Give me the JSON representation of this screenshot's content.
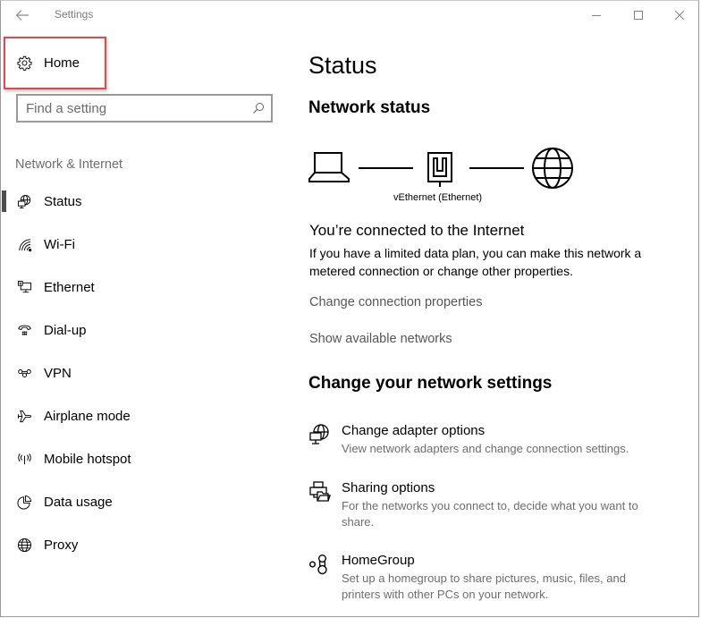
{
  "window": {
    "title": "Settings",
    "controls": {
      "back_icon": "arrow-left-icon",
      "minimize_icon": "minimize-icon",
      "maximize_icon": "maximize-icon",
      "close_icon": "close-icon"
    }
  },
  "sidebar": {
    "home": {
      "label": "Home",
      "icon": "gear-icon",
      "highlight_color": "#e5474b"
    },
    "search": {
      "placeholder": "Find a setting",
      "value": "",
      "icon": "search-icon"
    },
    "section_label": "Network & Internet",
    "items": [
      {
        "label": "Status",
        "icon": "globe-monitor-icon",
        "active": true
      },
      {
        "label": "Wi-Fi",
        "icon": "wifi-icon",
        "active": false
      },
      {
        "label": "Ethernet",
        "icon": "ethernet-icon",
        "active": false
      },
      {
        "label": "Dial-up",
        "icon": "phone-icon",
        "active": false
      },
      {
        "label": "VPN",
        "icon": "vpn-icon",
        "active": false
      },
      {
        "label": "Airplane mode",
        "icon": "airplane-icon",
        "active": false
      },
      {
        "label": "Mobile hotspot",
        "icon": "hotspot-icon",
        "active": false
      },
      {
        "label": "Data usage",
        "icon": "pie-chart-icon",
        "active": false
      },
      {
        "label": "Proxy",
        "icon": "globe-icon",
        "active": false
      }
    ]
  },
  "main": {
    "page_title": "Status",
    "network_status": {
      "heading": "Network status",
      "adapter_label": "vEthernet (Ethernet)",
      "diagram_icons": [
        "laptop-icon",
        "ethernet-port-icon",
        "globe-icon"
      ]
    },
    "connection": {
      "title": "You’re connected to the Internet",
      "description": "If you have a limited data plan, you can make this network a metered connection or change other properties.",
      "links": [
        {
          "label": "Change connection properties"
        },
        {
          "label": "Show available networks"
        }
      ]
    },
    "change_settings": {
      "heading": "Change your network settings",
      "options": [
        {
          "title": "Change adapter options",
          "description": "View network adapters and change connection settings.",
          "icon": "adapter-globe-icon"
        },
        {
          "title": "Sharing options",
          "description": "For the networks you connect to, decide what you want to share.",
          "icon": "sharing-printer-folder-icon"
        },
        {
          "title": "HomeGroup",
          "description": "Set up a homegroup to share pictures, music, files, and printers with other PCs on your network.",
          "icon": "homegroup-icon"
        }
      ]
    }
  }
}
